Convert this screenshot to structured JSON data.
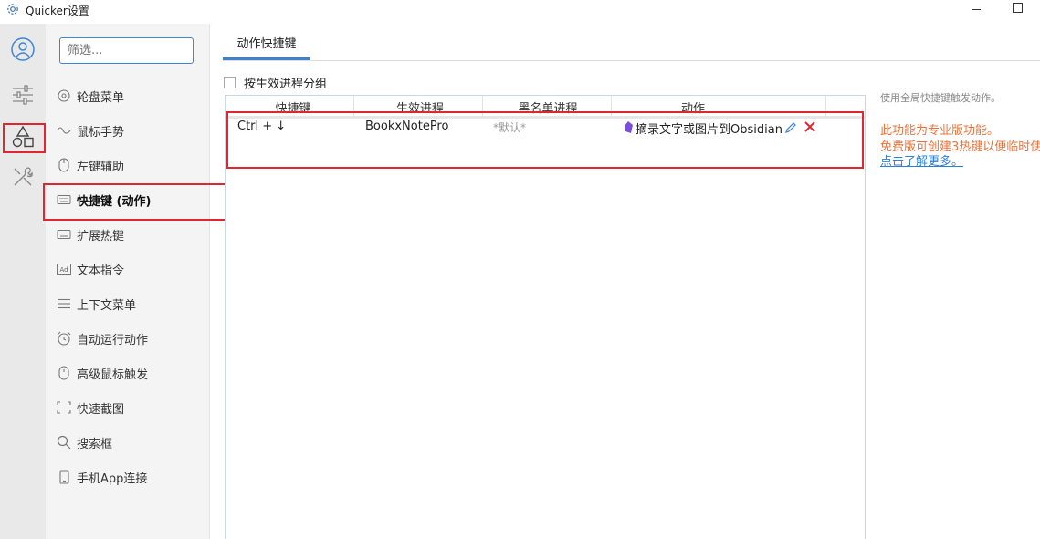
{
  "window": {
    "title": "Quicker设置"
  },
  "colors": {
    "accent": "#3c83cc",
    "highlight": "#e0262e",
    "pro_text": "#e9733a",
    "link": "#2f7fd6"
  },
  "rail": {
    "icons": [
      "user-icon",
      "sliders-icon",
      "shapes-icon",
      "tools-icon"
    ]
  },
  "sidebar": {
    "filter": {
      "placeholder": "筛选..."
    },
    "items": [
      {
        "label": "轮盘菜单",
        "icon": "wheel-icon"
      },
      {
        "label": "鼠标手势",
        "icon": "gesture-icon"
      },
      {
        "label": "左键辅助",
        "icon": "mouse-icon"
      },
      {
        "label": "快捷键 (动作)",
        "icon": "keyboard-icon",
        "active": true
      },
      {
        "label": "扩展热键",
        "icon": "keyboard-icon"
      },
      {
        "label": "文本指令",
        "icon": "text-command-icon"
      },
      {
        "label": "上下文菜单",
        "icon": "menu-lines-icon"
      },
      {
        "label": "自动运行动作",
        "icon": "alarm-clock-icon"
      },
      {
        "label": "高级鼠标触发",
        "icon": "mouse-icon"
      },
      {
        "label": "快速截图",
        "icon": "screenshot-icon"
      },
      {
        "label": "搜索框",
        "icon": "search-icon"
      },
      {
        "label": "手机App连接",
        "icon": "phone-icon"
      }
    ]
  },
  "main": {
    "tab": "动作快捷键",
    "group_by_process": {
      "label": "按生效进程分组",
      "checked": false
    },
    "table": {
      "columns": [
        "快捷键",
        "生效进程",
        "黑名单进程",
        "动作"
      ],
      "rows": [
        {
          "hotkey": "Ctrl + ↓",
          "process": "BookxNotePro",
          "blacklist": "*默认*",
          "action": "摘录文字或图片到Obsidian",
          "action_icon": "obsidian-icon"
        }
      ]
    },
    "info": {
      "description": "使用全局快捷键触发动作。",
      "pro_notice": "此功能为专业版功能。",
      "free_notice": "免费版可创建3热键以便临时使",
      "learn_more": "点击了解更多。"
    }
  }
}
